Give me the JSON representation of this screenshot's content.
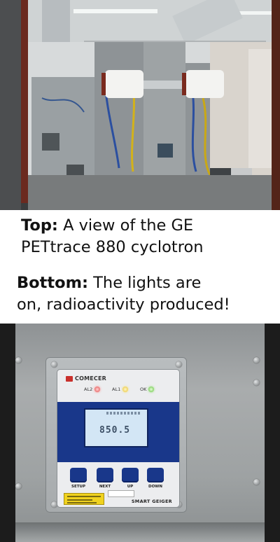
{
  "captions": {
    "top_label": "Top:",
    "top_text": " A view of the GE",
    "top_text_2": "PETtrace 880 cyclotron",
    "bottom_label": "Bottom:",
    "bottom_text": " The lights are",
    "bottom_text_2": "on, radioactivity produced!"
  },
  "device": {
    "brand": "COMECER",
    "model": "SMART GEIGER",
    "leds": [
      {
        "label": "AL2",
        "color": "red"
      },
      {
        "label": "AL1",
        "color": "yellow"
      },
      {
        "label": "OK",
        "color": "green"
      }
    ],
    "lcd_value": "850.5",
    "buttons": [
      "SETUP",
      "NEXT",
      "UP",
      "DOWN"
    ]
  },
  "colors": {
    "device_blue": "#19378a",
    "brand_red": "#c9302c",
    "lcd_background": "#d3e6f5"
  }
}
